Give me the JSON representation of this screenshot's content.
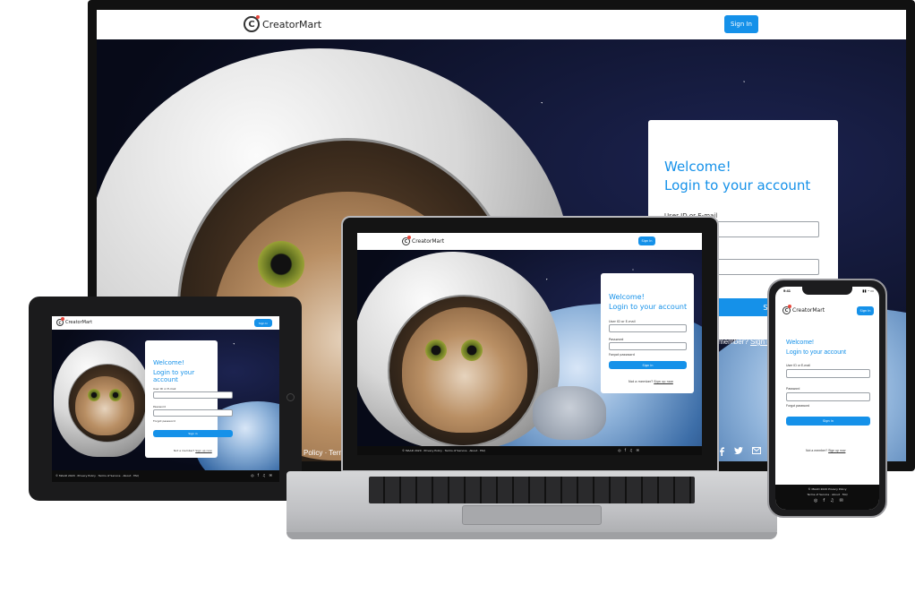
{
  "brand": {
    "name": "CreatorMart",
    "accent": "#1591e9"
  },
  "nav": {
    "signin_label": "Sign In"
  },
  "login": {
    "welcome": "Welcome!",
    "subtitle": "Login to your account",
    "user_label": "User ID or E-mail",
    "password_label": "Password",
    "forgot": "Forgot password",
    "signin_label": "Sign in",
    "member_prompt": "Not a member?",
    "signup_link": "Sign up now"
  },
  "monitor": {
    "member_prompt_partial": "member?",
    "signup_partial": "Sign up",
    "footer_partial": "Policy · Term"
  },
  "footer": {
    "copyright": "© MAAD 2020",
    "privacy": "Privacy Policy",
    "terms": "Terms of Service",
    "about": "About",
    "faq": "FAQ",
    "line": "© MAAD 2020 · Privacy Policy · Terms of Service · About · FAQ",
    "mobile_line1": "© MAAD 2020 Privacy Policy",
    "mobile_line2": "Terms of Service · About · FAQ"
  },
  "phone_status": {
    "time": "9:41"
  },
  "icons": [
    "instagram-icon",
    "facebook-icon",
    "twitter-icon",
    "mail-icon"
  ]
}
